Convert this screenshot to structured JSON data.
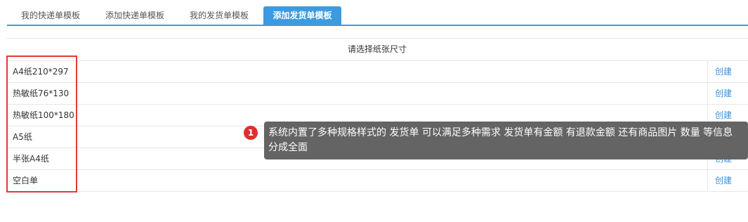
{
  "tabs": [
    {
      "label": "我的快递单模板",
      "active": false
    },
    {
      "label": "添加快递单模板",
      "active": false
    },
    {
      "label": "我的发货单模板",
      "active": false
    },
    {
      "label": "添加发货单模板",
      "active": true
    }
  ],
  "table": {
    "header": "请选择纸张尺寸",
    "rows": [
      {
        "name": "A4纸210*297",
        "action": "创建"
      },
      {
        "name": "热敏纸76*130",
        "action": "创建"
      },
      {
        "name": "热敏纸100*180",
        "action": "创建"
      },
      {
        "name": "A5纸",
        "action": "创建"
      },
      {
        "name": "半张A4纸",
        "action": "创建"
      },
      {
        "name": "空白单",
        "action": "创建"
      }
    ]
  },
  "annotation": {
    "badge": "1",
    "text": "系统内置了多种规格样式的 发货单  可以满足多种需求  发货单有金额 有退款金额 还有商品图片 数量 等信息 分成全面"
  },
  "colors": {
    "accent": "#3c9be0",
    "link": "#3c8fd6",
    "highlight": "#e03a3a",
    "tooltip_bg": "#5f5f5f"
  }
}
